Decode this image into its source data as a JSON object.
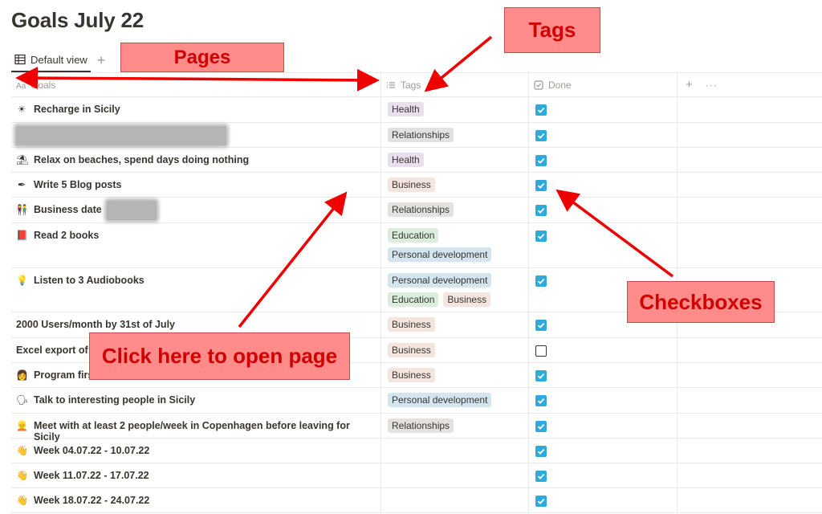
{
  "page": {
    "title": "Goals July 22"
  },
  "views": {
    "default_label": "Default view",
    "add_label": "+"
  },
  "columns": {
    "name": "Goals",
    "tags": "Tags",
    "done": "Done",
    "add": "+",
    "more": "···"
  },
  "colors": {
    "checkbox": "#2eaadc",
    "tag_health": "#e8deee",
    "tag_relationships": "#e3e2e0",
    "tag_business": "#f4e6df",
    "tag_education": "#dbeddb",
    "tag_personal_development": "#d3e5ef",
    "callout_fill": "#ff8b8b",
    "callout_text": "#d00000",
    "arrow": "#ee0000"
  },
  "rows": [
    {
      "icon": "sun-icon",
      "emoji": "☀",
      "name": "Recharge in Sicily",
      "tags": [
        "Health"
      ],
      "done": true
    },
    {
      "icon": "",
      "emoji": "",
      "name": "",
      "redacted": true,
      "tags": [
        "Relationships"
      ],
      "done": true
    },
    {
      "icon": "beach-icon",
      "emoji": "⛱",
      "name": "Relax on beaches, spend days doing nothing",
      "tags": [
        "Health"
      ],
      "done": true
    },
    {
      "icon": "pen-icon",
      "emoji": "✒",
      "name": "Write 5 Blog posts",
      "tags": [
        "Business"
      ],
      "done": true
    },
    {
      "icon": "couple-icon",
      "emoji": "👫",
      "name": "Business date",
      "partial_redacted": true,
      "tags": [
        "Relationships"
      ],
      "done": true
    },
    {
      "icon": "book-icon",
      "emoji": "📕",
      "name": "Read 2 books",
      "tags": [
        "Education",
        "Personal development"
      ],
      "done": true
    },
    {
      "icon": "bulb-icon",
      "emoji": "💡",
      "name": "Listen to 3 Audiobooks",
      "tags": [
        "Personal development",
        "Education",
        "Business"
      ],
      "done": true
    },
    {
      "icon": "",
      "emoji": "",
      "name": "2000 Users/month by 31st of July",
      "tags": [
        "Business"
      ],
      "done": true
    },
    {
      "icon": "",
      "emoji": "",
      "name": "Excel export of",
      "tags": [
        "Business"
      ],
      "done": false
    },
    {
      "icon": "programmer-icon",
      "emoji": "👩",
      "name": "Program first",
      "tags": [
        "Business"
      ],
      "done": true
    },
    {
      "icon": "speaking-head-icon",
      "emoji": "🗣",
      "name": "Talk to interesting people in Sicily",
      "tags": [
        "Personal development"
      ],
      "done": true
    },
    {
      "icon": "person-icon",
      "emoji": "👱",
      "name": "Meet with at least 2 people/week in Copenhagen before leaving for Sicily",
      "tags": [
        "Relationships"
      ],
      "done": true
    },
    {
      "icon": "wave-hand-icon",
      "emoji": "👋",
      "name": "Week 04.07.22 - 10.07.22",
      "tags": [],
      "done": true
    },
    {
      "icon": "wave-hand-icon",
      "emoji": "👋",
      "name": "Week 11.07.22 - 17.07.22",
      "tags": [],
      "done": true
    },
    {
      "icon": "wave-hand-icon",
      "emoji": "👋",
      "name": "Week 18.07.22 - 24.07.22",
      "tags": [],
      "done": true
    }
  ],
  "annotations": {
    "pages": "Pages",
    "tags": "Tags",
    "checkboxes": "Checkboxes",
    "open_page": "Click here to open page"
  }
}
